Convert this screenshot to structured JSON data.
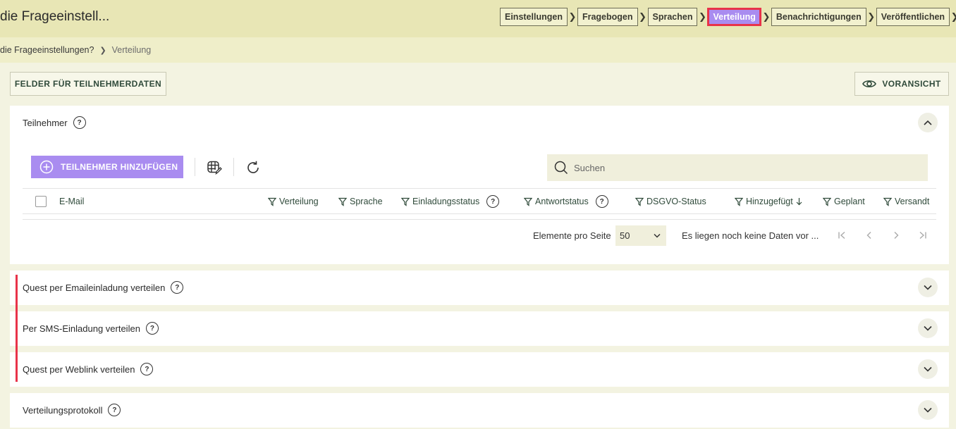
{
  "header": {
    "title": "die Frageeinstell...",
    "steps": [
      "Einstellungen",
      "Fragebogen",
      "Sprachen",
      "Verteilung",
      "Benachrichtigungen",
      "Veröffentlichen"
    ],
    "active_step": "Verteilung"
  },
  "breadcrumb": {
    "parent": "die Frageeinstellungen?",
    "current": "Verteilung"
  },
  "toolbar": {
    "fields_button": "FELDER FÜR TEILNEHMERDATEN",
    "preview_button": "VORANSICHT"
  },
  "participants": {
    "title": "Teilnehmer",
    "add_button": "TEILNEHMER HINZUFÜGEN",
    "search_placeholder": "Suchen",
    "columns": {
      "email": "E-Mail",
      "distribution": "Verteilung",
      "language": "Sprache",
      "invitation_status": "Einladungsstatus",
      "response_status": "Antwortstatus",
      "gdpr_status": "DSGVO-Status",
      "added": "Hinzugefügt",
      "planned": "Geplant",
      "sent": "Versandt"
    },
    "pager": {
      "label": "Elemente pro Seite",
      "page_size": "50",
      "info": "Es liegen noch keine Daten vor ..."
    }
  },
  "sections": {
    "email": "Quest per Emaileinladung verteilen",
    "sms": "Per SMS-Einladung verteilen",
    "weblink": "Quest per Weblink verteilen",
    "log": "Verteilungsprotokoll"
  },
  "help_glyph": "?",
  "colors": {
    "accent": "#a98cf0",
    "highlight": "#e8334a",
    "header_bg": "#e8e6b5"
  }
}
